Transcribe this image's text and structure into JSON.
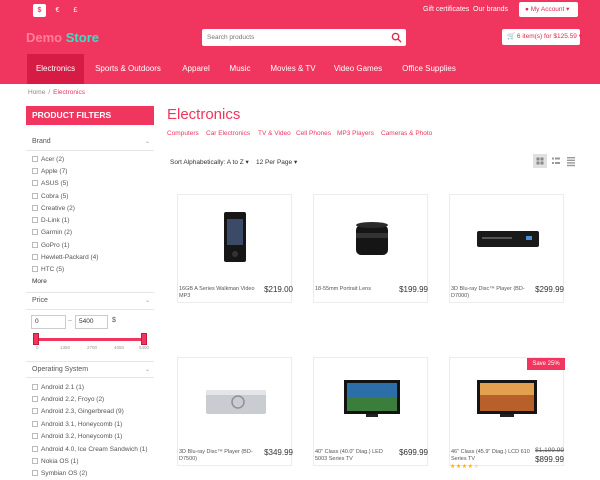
{
  "topbar": {
    "currencies": [
      "$",
      "€",
      "£"
    ],
    "gift_label": "Gift certificates",
    "brands_label": "Our brands",
    "account_label": "My Account"
  },
  "header": {
    "logo_part1": "Demo",
    "logo_part2": "Store",
    "search_placeholder": "Search products",
    "cart_label": "6 item(s) for $125.59"
  },
  "nav": {
    "items": [
      "Electronics",
      "Sports & Outdoors",
      "Apparel",
      "Music",
      "Movies & TV",
      "Video Games",
      "Office Supplies"
    ]
  },
  "breadcrumb": {
    "home": "Home",
    "sep": "/",
    "current": "Electronics"
  },
  "filters": {
    "title": "PRODUCT FILTERS",
    "brand_title": "Brand",
    "brands": [
      "Acer (2)",
      "Apple (7)",
      "ASUS (5)",
      "Cobra (5)",
      "Creative (2)",
      "D-Link (1)",
      "Garmin (2)",
      "GoPro (1)",
      "Hewlett-Packard (4)",
      "HTC (5)"
    ],
    "more_label": "More",
    "price_title": "Price",
    "price_min": "0",
    "price_dash": "–",
    "price_max": "5400",
    "currency": "$",
    "ticks": [
      "0",
      "1350",
      "2700",
      "4050",
      "5400"
    ],
    "os_title": "Operating System",
    "os": [
      "Android 2.1 (1)",
      "Android 2.2, Froyo (2)",
      "Android 2.3, Gingerbread (9)",
      "Android 3.1, Honeycomb (1)",
      "Android 3.2, Honeycomb (1)",
      "Android 4.0, Ice Cream Sandwich (1)",
      "Nokia OS (1)",
      "Symbian OS (2)"
    ]
  },
  "main": {
    "title": "Electronics",
    "subcategories": [
      "Computers",
      "Car Electronics",
      "TV & Video",
      "Cell Phones",
      "MP3 Players",
      "Cameras & Photo"
    ],
    "sort_label": "Sort Alphabetically: A to Z",
    "per_page_label": "12 Per Page"
  },
  "products": [
    {
      "name": "16GB A Series Walkman Video MP3",
      "price": "$219.00"
    },
    {
      "name": "18-55mm Portrait Lens",
      "price": "$199.99"
    },
    {
      "name": "3D Blu-ray Disc™ Player (BD-D7000)",
      "price": "$299.99"
    },
    {
      "name": "3D Blu-ray Disc™ Player (BD-D7500)",
      "price": "$349.99"
    },
    {
      "name": "40\" Class (40.0\" Diag.) LED 5003 Series TV",
      "price": "$699.99"
    },
    {
      "name": "46\" Class (45.9\" Diag.) LCD 610 Series TV",
      "price": "$899.99",
      "old_price": "$1,199.99",
      "badge": "Save 25%",
      "rating": 4
    }
  ],
  "colors": {
    "accent": "#f0365e",
    "accent_dark": "#d61b45",
    "logo_teal": "#36e3c6"
  }
}
